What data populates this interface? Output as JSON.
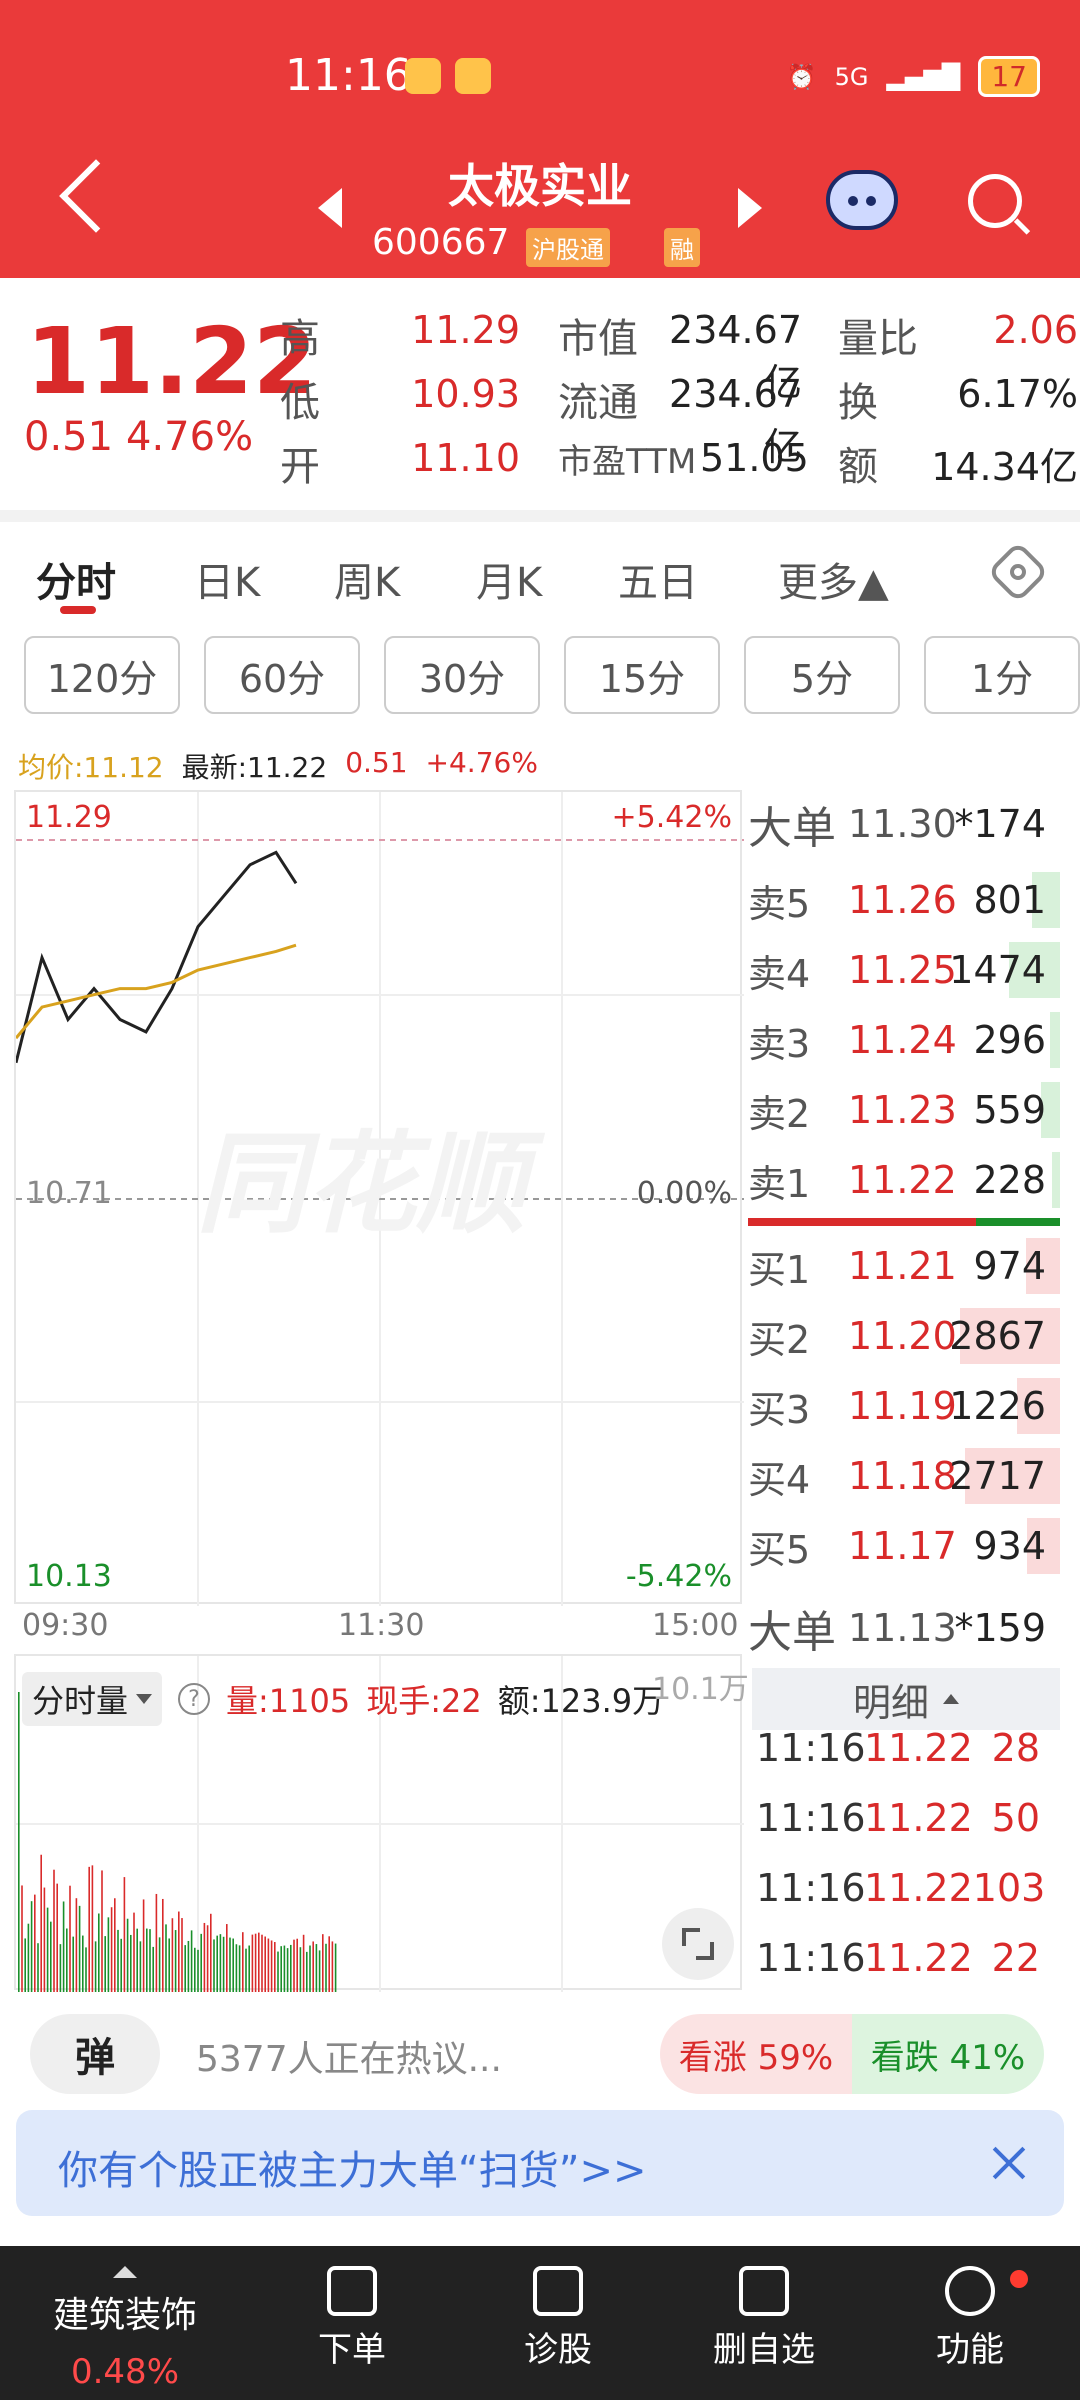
{
  "status_bar": {
    "time": "11:16",
    "battery": "17",
    "network": "5G"
  },
  "header": {
    "stock_name": "太极实业",
    "stock_code": "600667",
    "tag_market": "沪股通",
    "tag_margin": "融"
  },
  "quote": {
    "price": "11.22",
    "change": "0.51",
    "change_pct": "4.76%",
    "fields": [
      {
        "label": "高",
        "value": "11.29",
        "color": "red"
      },
      {
        "label": "低",
        "value": "10.93",
        "color": "red"
      },
      {
        "label": "开",
        "value": "11.10",
        "color": "red"
      },
      {
        "label": "市值",
        "value": "234.67亿",
        "color": "dark"
      },
      {
        "label": "流通",
        "value": "234.67亿",
        "color": "dark"
      },
      {
        "label": "市盈TTM",
        "value": "51.05",
        "color": "dark"
      },
      {
        "label": "量比",
        "value": "2.06",
        "color": "red"
      },
      {
        "label": "换",
        "value": "6.17%",
        "color": "dark"
      },
      {
        "label": "额",
        "value": "14.34亿",
        "color": "dark"
      }
    ]
  },
  "tabs": [
    "分时",
    "日K",
    "周K",
    "月K",
    "五日",
    "更多▲"
  ],
  "periods": [
    "120分",
    "60分",
    "30分",
    "15分",
    "5分",
    "1分"
  ],
  "chart": {
    "avg_label": "均价:11.12",
    "latest_label": "最新:11.22",
    "latest_change": "0.51",
    "latest_pct": "+4.76%",
    "price_high": "11.29",
    "price_mid": "10.71",
    "price_low": "10.13",
    "pct_high": "+5.42%",
    "pct_mid": "0.00%",
    "pct_low": "-5.42%",
    "time_start": "09:30",
    "time_mid": "11:30",
    "time_end": "15:00",
    "watermark": "同花顺"
  },
  "chart_data": {
    "type": "line",
    "title": "",
    "ylim": [
      10.13,
      11.29
    ],
    "x": [
      "09:30",
      "09:40",
      "09:50",
      "10:00",
      "10:10",
      "10:20",
      "10:30",
      "10:40",
      "10:50",
      "11:00",
      "11:10",
      "11:16"
    ],
    "series": [
      {
        "name": "最新",
        "values": [
          10.93,
          11.1,
          11.0,
          11.05,
          11.0,
          10.98,
          11.05,
          11.15,
          11.2,
          11.25,
          11.27,
          11.22
        ]
      },
      {
        "name": "均价",
        "values": [
          10.97,
          11.02,
          11.03,
          11.04,
          11.05,
          11.05,
          11.06,
          11.08,
          11.09,
          11.1,
          11.11,
          11.12
        ]
      }
    ]
  },
  "volume": {
    "dropdown": "分时量",
    "qty_label": "量:1105",
    "hand_label": "现手:22",
    "amount_label": "额:123.9万",
    "max_label": "10.1万"
  },
  "order_book": {
    "big_sell": {
      "label": "大单",
      "price": "11.30",
      "qty": "*174"
    },
    "sells": [
      {
        "label": "卖5",
        "price": "11.26",
        "qty": "801",
        "bar": 0.28
      },
      {
        "label": "卖4",
        "price": "11.25",
        "qty": "1474",
        "bar": 0.51
      },
      {
        "label": "卖3",
        "price": "11.24",
        "qty": "296",
        "bar": 0.1
      },
      {
        "label": "卖2",
        "price": "11.23",
        "qty": "559",
        "bar": 0.19
      },
      {
        "label": "卖1",
        "price": "11.22",
        "qty": "228",
        "bar": 0.08
      }
    ],
    "buys": [
      {
        "label": "买1",
        "price": "11.21",
        "qty": "974",
        "bar": 0.34
      },
      {
        "label": "买2",
        "price": "11.20",
        "qty": "2867",
        "bar": 1.0
      },
      {
        "label": "买3",
        "price": "11.19",
        "qty": "1226",
        "bar": 0.43
      },
      {
        "label": "买4",
        "price": "11.18",
        "qty": "2717",
        "bar": 0.95
      },
      {
        "label": "买5",
        "price": "11.17",
        "qty": "934",
        "bar": 0.33
      }
    ],
    "big_buy": {
      "label": "大单",
      "price": "11.13",
      "qty": "*159"
    }
  },
  "trades_header": "明细",
  "trades": [
    {
      "time": "11:16",
      "price": "11.22",
      "vol": "28"
    },
    {
      "time": "11:16",
      "price": "11.22",
      "vol": "50"
    },
    {
      "time": "11:16",
      "price": "11.22",
      "vol": "103"
    },
    {
      "time": "11:16",
      "price": "11.22",
      "vol": "22"
    }
  ],
  "discussion": {
    "danmu_label": "弹",
    "hot_text": "5377人正在热议...",
    "bull": "看涨 59%",
    "bear": "看跌 41%"
  },
  "banner": {
    "text": "你有个股正被主力大单“扫货”>>"
  },
  "bottom_nav": {
    "sector_name": "建筑装饰",
    "sector_pct": "0.48%",
    "items": [
      "下单",
      "诊股",
      "删自选",
      "功能"
    ]
  },
  "colors": {
    "header": "#ea3a3a",
    "up": "#d92a2a",
    "down": "#1a8f2a",
    "avg_line": "#d8a21e"
  }
}
